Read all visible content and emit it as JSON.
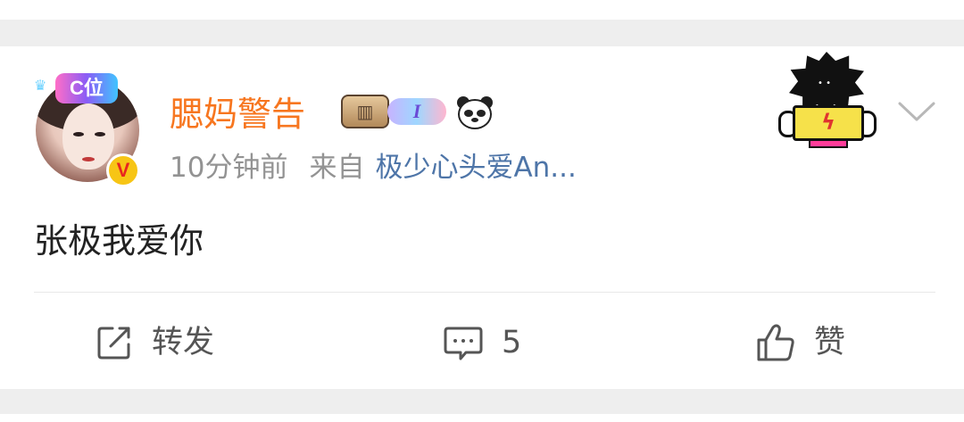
{
  "post": {
    "author": {
      "name": "腮妈警告",
      "avatar_pendant_text": "C位",
      "verified_badge": "V",
      "badges": [
        "jacket-badge-icon",
        "I",
        "panda-icon"
      ]
    },
    "time": "10分钟前",
    "from_label": "来自",
    "source": "极少心头爱An...",
    "text": "张极我爱你"
  },
  "actions": {
    "share_label": "转发",
    "comment_count": "5",
    "like_label": "赞"
  },
  "icons": {
    "more": "chevron-down-icon",
    "share": "share-icon",
    "comment": "comment-icon",
    "like": "thumbs-up-icon"
  },
  "colors": {
    "username": "#f7761f",
    "source_link": "#4e75a8",
    "meta_text": "#939393",
    "action_text": "#555555",
    "separator": "#eeeeee"
  }
}
